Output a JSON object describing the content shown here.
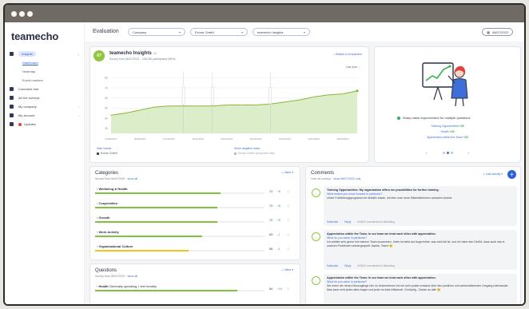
{
  "app": {
    "logo": "teamecho"
  },
  "sidebar": {
    "items": [
      {
        "label": "Insights",
        "icon": "chart-icon",
        "active": true,
        "chev": "⌄"
      },
      {
        "label": "Dashboard",
        "sub": true,
        "link": true
      },
      {
        "label": "Heatmap",
        "sub": true
      },
      {
        "label": "Event markers",
        "sub": true
      },
      {
        "label": "Comment hub",
        "icon": "comment-icon"
      },
      {
        "label": "All live surveys",
        "icon": "list-icon"
      },
      {
        "label": "My company",
        "icon": "building-icon",
        "chev": "›"
      },
      {
        "label": "My account",
        "icon": "user-icon",
        "chev": "›"
      },
      {
        "label": "Updates",
        "icon": "megaphone-icon",
        "dot": true
      }
    ]
  },
  "header": {
    "title": "Evaluation",
    "filters": [
      "Company",
      "Echoe GmbH",
      "teamecho Insights"
    ],
    "date": "06/07/2022"
  },
  "insights": {
    "score": "67",
    "title": "teamecho Insights",
    "version": "v2",
    "meta": "Survey from 06/07/2022 · 136/136 participated (98%)",
    "link": "Details & comparison",
    "period": "Last year",
    "legend_link_1": "Hide values",
    "legend_company": "Echoe GmbH",
    "legend_link_2": "Show negative index",
    "legend_compare": "Echoe GmbH (response rate)"
  },
  "chart_data": {
    "type": "area",
    "x": [
      "03/08/2021",
      "20/08/2021",
      "08/09/2021",
      "26/09/2021",
      "14/10/2021",
      "01/11/2021",
      "19/11/2021",
      "07/12/2021",
      "25/12/2021",
      "12/01/2022",
      "30/01/2022",
      "17/02/2022",
      "07/03/2022",
      "25/03/2022",
      "12/04/2022",
      "30/04/2022",
      "18/05/2022",
      "06/06/2022"
    ],
    "series": [
      {
        "values": [
          43,
          45,
          48,
          51,
          52,
          52,
          52,
          52,
          53,
          53,
          53,
          54,
          56,
          58,
          61,
          63,
          64,
          67
        ]
      }
    ],
    "y_ticks": [
      30,
      40,
      50,
      60,
      70,
      80
    ],
    "ylim": [
      25,
      85
    ],
    "markers": [
      5,
      7,
      11
    ],
    "grid": true
  },
  "highlight": {
    "headline": "Sharp value improvement for multiple questions",
    "lines": [
      {
        "label": "Training Opportunities",
        "delta": "+25"
      },
      {
        "label": "Health",
        "delta": "+24"
      },
      {
        "label": "Appreciation within the Team",
        "delta": "+22"
      }
    ],
    "prev": "‹",
    "next": "›"
  },
  "categories": {
    "title": "Categories",
    "meta": "Survey from 06/07/2022 · ",
    "meta_link": "show all",
    "sort": "Value ▾",
    "items": [
      {
        "name": "Wellbeing & Health",
        "value": "74",
        "delta": "+8",
        "pct": 74,
        "color": "#7ec242",
        "dcolor": "#3aa046"
      },
      {
        "name": "Cooperation",
        "value": "72",
        "delta": "+8",
        "pct": 72,
        "color": "#7ec242",
        "dcolor": "#3aa046"
      },
      {
        "name": "Growth",
        "value": "72",
        "delta": "+8",
        "pct": 72,
        "color": "#7ec242",
        "dcolor": "#3aa046"
      },
      {
        "name": "Work Activity",
        "value": "63",
        "delta": "-1",
        "pct": 63,
        "color": "#7ec242",
        "dcolor": "#e0433c"
      },
      {
        "name": "Organizational Culture",
        "value": "55",
        "delta": "-4",
        "pct": 55,
        "color": "#f2c41c",
        "dcolor": "#e0433c"
      }
    ]
  },
  "questions": {
    "title": "Questions",
    "meta": "Survey from 06/07/2022 · ",
    "meta_link": "show all",
    "sort": "Value ▾",
    "item": {
      "name": "Health",
      "desc": "Generally speaking, I feel healthy",
      "value": "84",
      "delta": "+24",
      "pct": 84
    }
  },
  "comments": {
    "title": "Comments",
    "meta": "Over all surveys · ",
    "meta_link": "show 06/07/2022 only",
    "filter": "Last activity ▾",
    "add": "+",
    "items": [
      {
        "title": "Training Opportunities: My organization offers me possibilities for further training.",
        "q": "What makes you move forward in particular?",
        "text": "Unser Fortbildungsprogramm ist definitiv etwas, mit dem man neue Mitarbeiterinnen anlocken könnte.",
        "subscribe": "Subscribe",
        "reply": "Reply",
        "when": "6/06/20 commented in Marketing"
      },
      {
        "title": "Appreciation within the Team: In our team we treat each other with appreciation.",
        "q": "What do you value in particular?",
        "text": "Ich arbeite sehr gerne mit meinem Team zusammen. Jeder ist stets auf Augenhöhe, was echt toll ist, und ich habe das Gefühl, dass auch das in unseren Problemen wiedergespielt. Danke, Team! 😊",
        "subscribe": "Subscribe",
        "reply": "Reply",
        "when": "6/06/20 commented in Marketing"
      },
      {
        "title": "Appreciation within the Team: In our team we treat each other with appreciation.",
        "q": "What do you value in particular?",
        "text": "Die einen der neuen Neuzugänge hier im Unternehmen bin ich sehr positiv erstaunt über den positiven und wertschätzenden Umgang miteinander. Man kann echt jeden alles fragen und jeder ist total hilfsbereit. Großartig - Danke an alle! 😊"
      }
    ]
  },
  "colors": {
    "accent": "#2d62d9",
    "positive": "#7ec242",
    "brand_green": "#8fc53f"
  }
}
